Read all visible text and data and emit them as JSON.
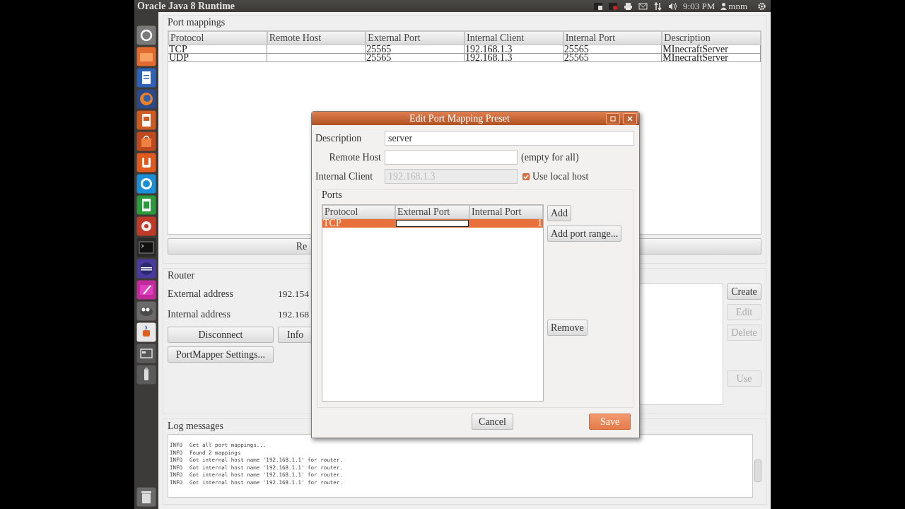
{
  "window": {
    "title": "Oracle Java 8 Runtime"
  },
  "top_bar": {
    "time": "9:03 PM",
    "user": "mnm"
  },
  "port_mappings": {
    "title": "Port mappings",
    "columns": [
      "Protocol",
      "Remote Host",
      "External Port",
      "Internal Client",
      "Internal Port",
      "Description"
    ],
    "rows": [
      {
        "protocol": "TCP",
        "external_port": "25565",
        "internal_client": "192.168.1.3",
        "internal_port": "25565",
        "description": "MInecraftServer"
      },
      {
        "protocol": "UDP",
        "external_port": "25565",
        "internal_client": "192.168.1.3",
        "internal_port": "25565",
        "description": "MInecraftServer"
      }
    ],
    "buttons": [
      {
        "label": "Re"
      }
    ]
  },
  "router": {
    "title": "Router",
    "fields": [
      {
        "label": "External address",
        "value": "192.154"
      },
      {
        "label": "Internal address",
        "value": "192.168"
      }
    ],
    "buttons": [
      {
        "label": "Disconnect"
      },
      {
        "label": "Info"
      },
      {
        "label": "PortMapper Settings..."
      }
    ],
    "preset_buttons": [
      {
        "label": "Create",
        "disabled": false
      },
      {
        "label": "Edit",
        "disabled": true
      },
      {
        "label": "Delete",
        "disabled": true
      },
      {
        "label": "Use",
        "disabled": true
      }
    ]
  },
  "log": {
    "title": "Log messages",
    "lines": [
      {
        "level": "INFO",
        "message": "Get all port mappings..."
      },
      {
        "level": "INFO",
        "message": "Found 2 mappings"
      },
      {
        "level": "INFO",
        "message": "Got internal host name '192.168.1.1' for router."
      },
      {
        "level": "INFO",
        "message": "Got internal host name '192.168.1.1' for router."
      },
      {
        "level": "INFO",
        "message": "Got internal host name '192.168.1.1' for router."
      },
      {
        "level": "INFO",
        "message": "Got internal host name '192.168.1.1' for router."
      }
    ]
  },
  "dialog": {
    "title": "Edit Port Mapping Preset",
    "description": {
      "label": "Description",
      "value": "server"
    },
    "remote_host": {
      "label": "Remote Host",
      "hint": "(empty for all)"
    },
    "internal_client": {
      "label": "Internal Client",
      "value": "192.168.1.3",
      "disabled": true
    },
    "use_local_host": {
      "label": "Use local host",
      "checked": true
    },
    "ports": {
      "title": "Ports",
      "columns": [
        "Protocol",
        "External Port",
        "Internal Port"
      ],
      "rows": [
        {
          "protocol": "TCP",
          "internal_port": "1",
          "selected": true
        }
      ],
      "buttons": [
        {
          "label": "Add"
        },
        {
          "label": "Add port range..."
        },
        {
          "label": "Remove"
        }
      ]
    },
    "footer_buttons": [
      {
        "label": "Cancel",
        "kind": "normal"
      },
      {
        "label": "Save",
        "kind": "default"
      }
    ]
  }
}
